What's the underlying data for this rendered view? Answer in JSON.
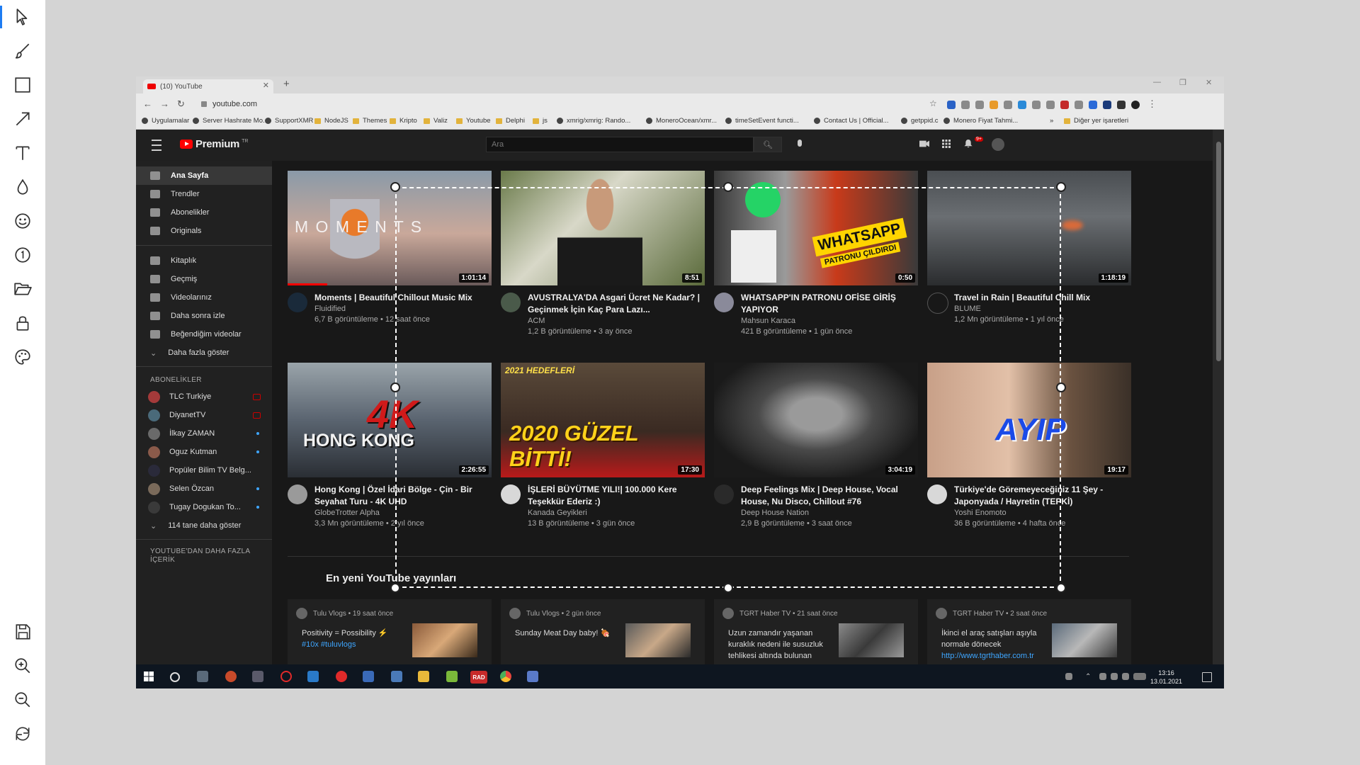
{
  "browser": {
    "tab_title": "(10) YouTube",
    "new_tab": "+",
    "tab_close": "✕",
    "url": "youtube.com",
    "bookmarks": [
      "Uygulamalar",
      "Server Hashrate Mo...",
      "SupportXMR",
      "NodeJS",
      "Themes",
      "Kripto",
      "Valiz",
      "Youtube",
      "Delphi",
      "js",
      "xmrig/xmrig: Rando...",
      "MoneroOcean/xmr...",
      "timeSetEvent functi...",
      "Contact Us | Official...",
      "getppid.c",
      "Monero Fiyat Tahmi...",
      "»",
      "Diğer yer işaretleri"
    ]
  },
  "youtube": {
    "logo_text": "Premium",
    "logo_tm": "TR",
    "search_placeholder": "Ara",
    "notification_count": "9+",
    "sidebar": {
      "main_items": [
        "Ana Sayfa",
        "Trendler",
        "Abonelikler",
        "Originals"
      ],
      "library_items": [
        "Kitaplık",
        "Geçmiş",
        "Videolarınız",
        "Daha sonra izle",
        "Beğendiğim videolar",
        "Daha fazla göster"
      ],
      "subscriptions_heading": "ABONELİKLER",
      "subscriptions": [
        "TLC Turkiye",
        "DiyanetTV",
        "İlkay ZAMAN",
        "Oguz Kutman",
        "Popüler Bilim TV Belg...",
        "Selen Özcan",
        "Tugay Dogukan To..."
      ],
      "show_more_subs": "114 tane daha göster",
      "more_heading_1": "YOUTUBE'DAN DAHA FAZLA",
      "more_heading_2": "İÇERİK"
    },
    "videos": [
      {
        "title": "Moments | Beautiful Chillout Music Mix",
        "channel": "Fluidified",
        "stats": "6,7 B görüntüleme • 12 saat önce",
        "duration": "1:01:14",
        "thumb_text": "M O M E N T S"
      },
      {
        "title": "AVUSTRALYA'DA Asgari Ücret Ne Kadar? | Geçinmek İçin Kaç Para Lazı...",
        "channel": "ACM",
        "stats": "1,2 B görüntüleme • 3 ay önce",
        "duration": "8:51",
        "thumb_text": ""
      },
      {
        "title": "WHATSAPP'IN PATRONU OFİSE GİRİŞ YAPIYOR",
        "channel": "Mahsun Karaca",
        "stats": "421 B görüntüleme • 1 gün önce",
        "duration": "0:50",
        "thumb_text": "WHATSAPP",
        "thumb_text_2": "PATRONU ÇILDIRDI"
      },
      {
        "title": "Travel in Rain | Beautiful Chill Mix",
        "channel": "BLUME",
        "stats": "1,2 Mn görüntüleme • 1 yıl önce",
        "duration": "1:18:19",
        "thumb_text": ""
      },
      {
        "title": "Hong Kong | Özel İdari Bölge - Çin - Bir Seyahat Turu - 4K UHD",
        "channel": "GlobeTrotter Alpha",
        "stats": "3,3 Mn görüntüleme • 2 yıl önce",
        "duration": "2:26:55",
        "thumb_text": "4K",
        "thumb_text_2": "HONG KONG"
      },
      {
        "title": "İŞLERİ BÜYÜTME YILI!| 100.000 Kere Teşekkür Ederiz :)",
        "channel": "Kanada Geyikleri",
        "stats": "13 B görüntüleme • 3 gün önce",
        "duration": "17:30",
        "thumb_text": "2021 HEDEFLERİ",
        "thumb_text_2": "2020 GÜZEL BİTTİ!"
      },
      {
        "title": "Deep Feelings Mix | Deep House, Vocal House, Nu Disco, Chillout #76",
        "channel": "Deep House Nation",
        "stats": "2,9 B görüntüleme • 3 saat önce",
        "duration": "3:04:19",
        "thumb_text": ""
      },
      {
        "title": "Türkiye'de Göremeyeceğiniz 11 Şey - Japonyada / Hayretin (TEPKİ)",
        "channel": "Yoshi Enomoto",
        "stats": "36 B görüntüleme • 4 hafta önce",
        "duration": "19:17",
        "thumb_text": "AYIP"
      }
    ],
    "section_title": "En yeni YouTube yayınları",
    "posts": [
      {
        "head": "Tulu Vlogs • 19 saat önce",
        "body": "Positivity = Possibility ⚡",
        "tag": "#10x #tuluvlogs"
      },
      {
        "head": "Tulu Vlogs • 2 gün önce",
        "body": "Sunday Meat Day baby! 🍖",
        "tag": ""
      },
      {
        "head": "TGRT Haber TV • 21 saat önce",
        "body": "Uzun zamandır yaşanan kuraklık nedeni ile susuzluk tehlikesi altında bulunan",
        "tag": ""
      },
      {
        "head": "TGRT Haber TV • 2 saat önce",
        "body": "İkinci el araç satışları aşıyla normale dönecek",
        "tag": "http://www.tgrthaber.com.tr"
      }
    ]
  },
  "taskbar": {
    "time": "13:16",
    "date": "13.01.2021",
    "rad_label": "RAD"
  },
  "colors": {
    "accent": "#1e7cf2",
    "yt_red": "#ff0000",
    "yt_bg": "#181818",
    "yt_sidebar": "#212121"
  }
}
